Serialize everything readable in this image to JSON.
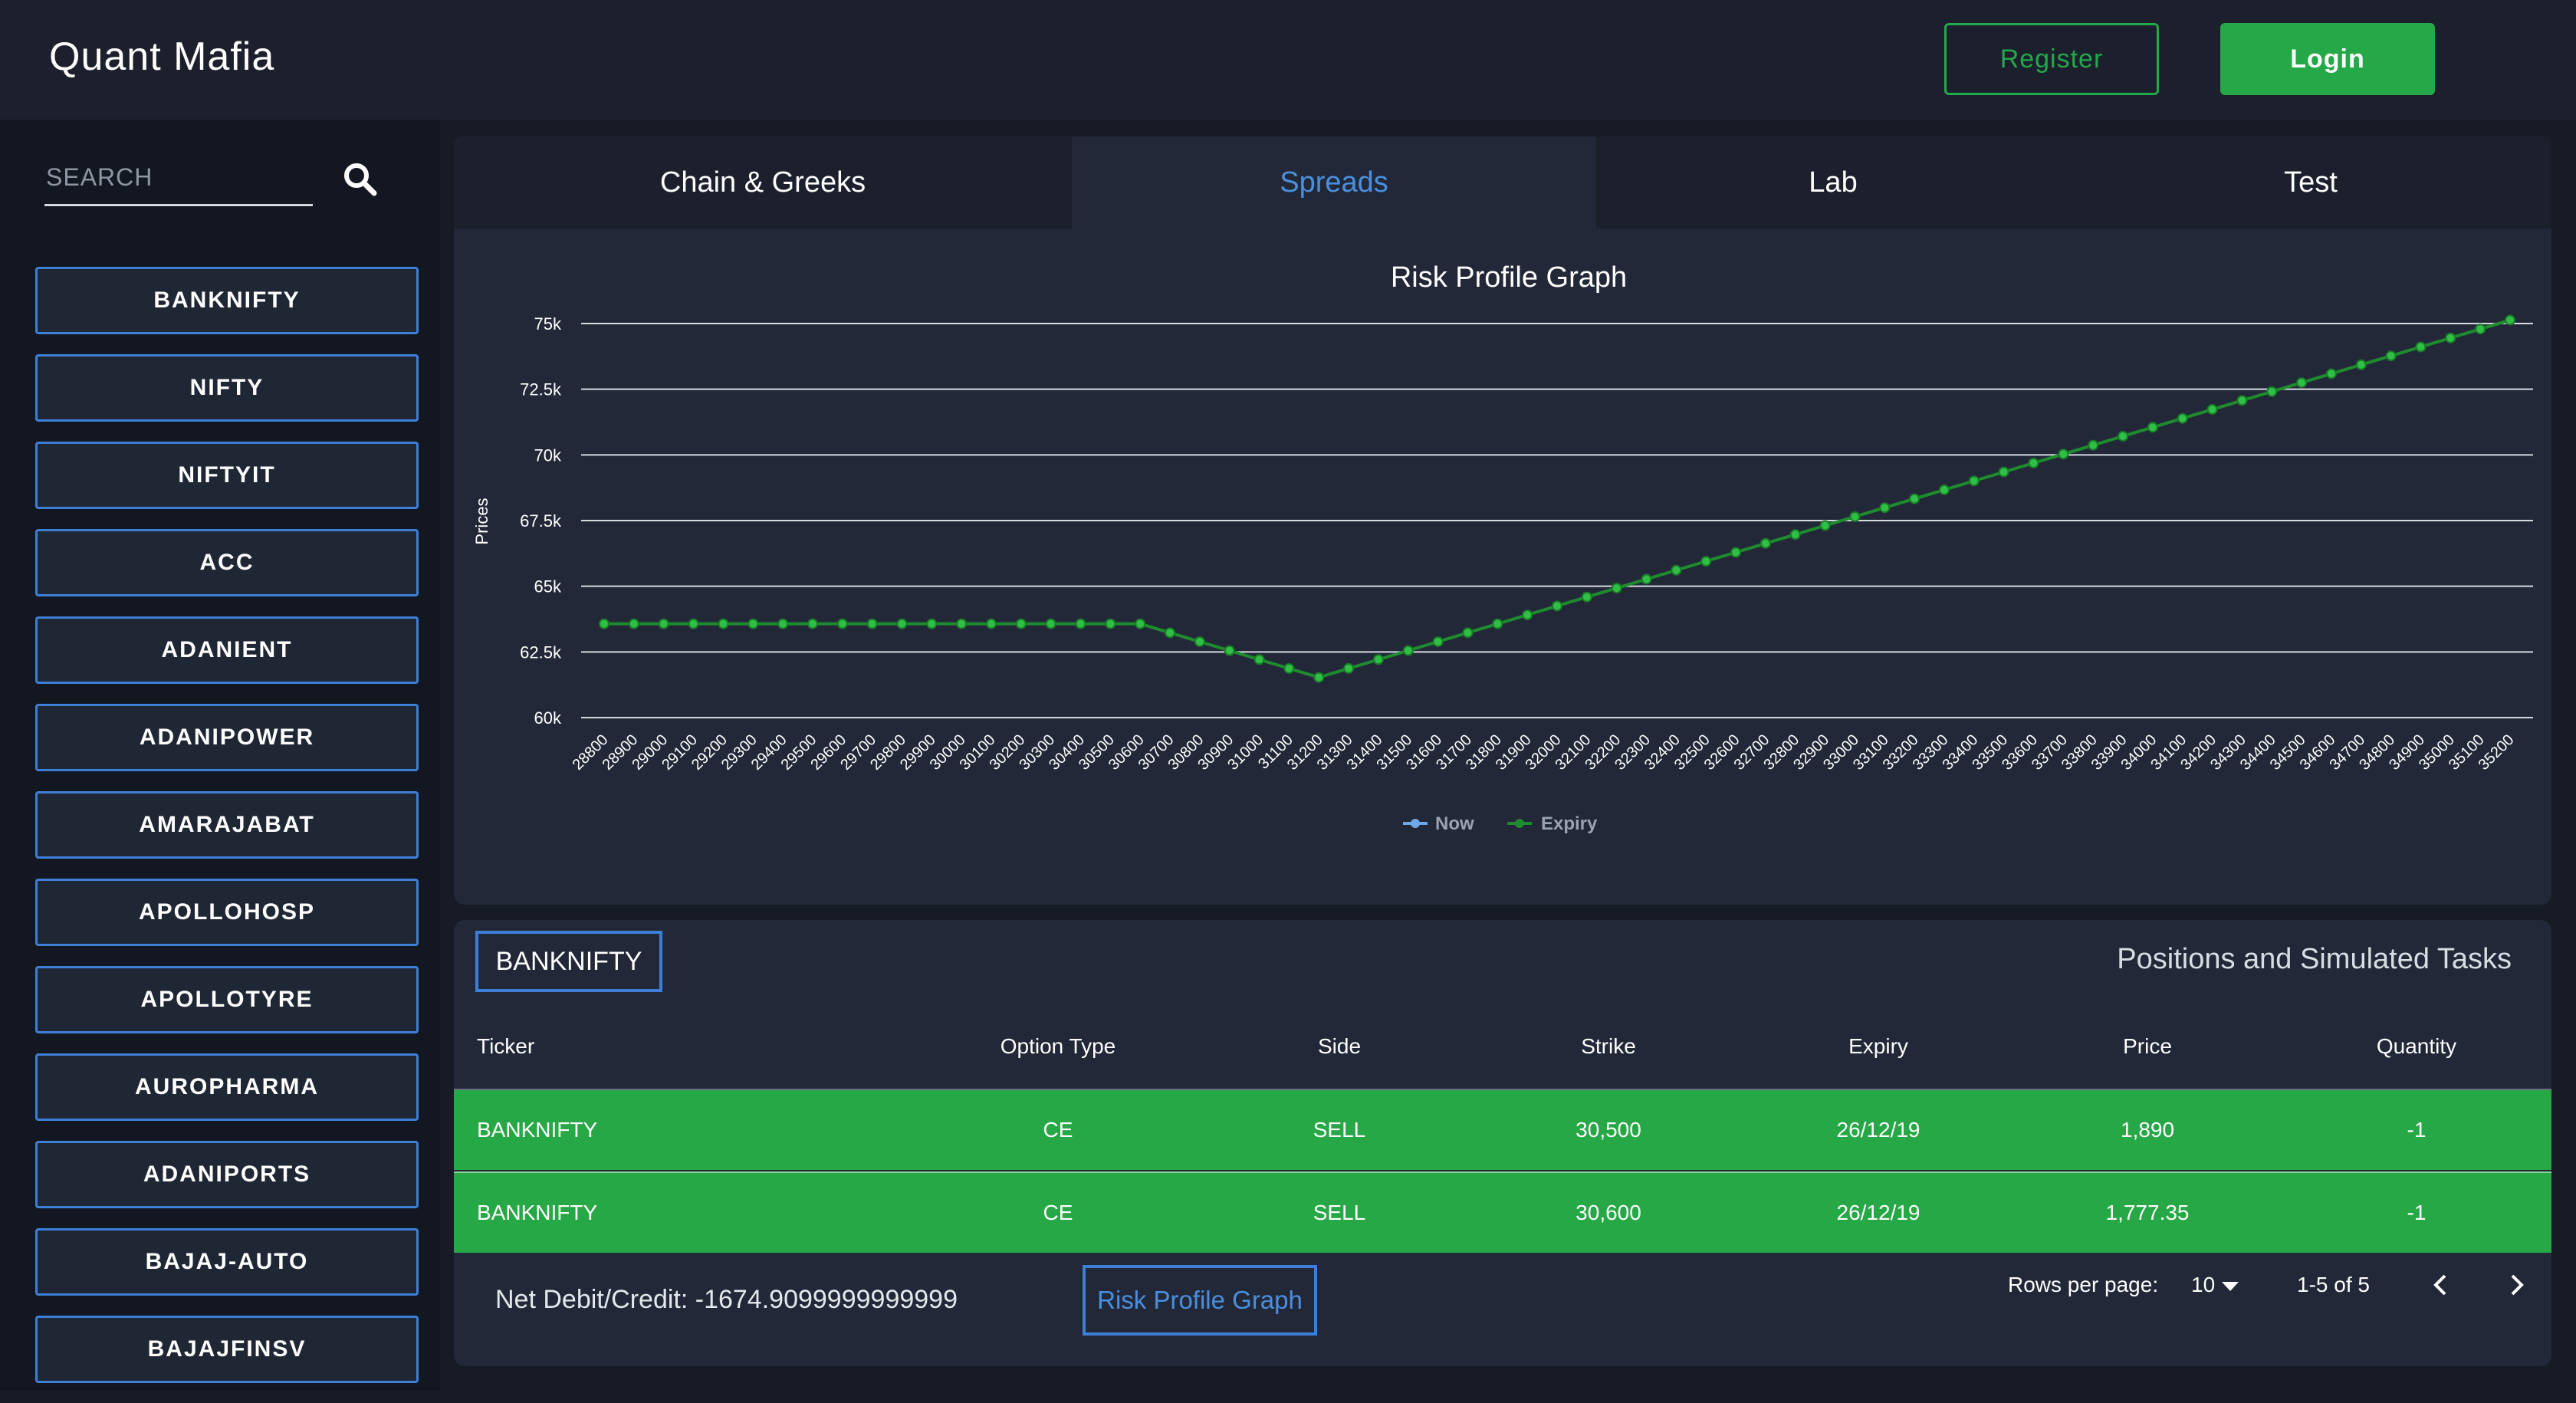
{
  "app": {
    "title": "Quant Mafia"
  },
  "header": {
    "register_label": "Register",
    "login_label": "Login"
  },
  "search": {
    "placeholder": "SEARCH"
  },
  "sidebar": {
    "tickers": [
      "BANKNIFTY",
      "NIFTY",
      "NIFTYIT",
      "ACC",
      "ADANIENT",
      "ADANIPOWER",
      "AMARAJABAT",
      "APOLLOHOSP",
      "APOLLOTYRE",
      "AUROPHARMA",
      "ADANIPORTS",
      "BAJAJ-AUTO",
      "BAJAJFINSV"
    ]
  },
  "tabs": [
    {
      "label": "Chain & Greeks",
      "active": false
    },
    {
      "label": "Spreads",
      "active": true
    },
    {
      "label": "Lab",
      "active": false
    },
    {
      "label": "Test",
      "active": false
    }
  ],
  "colors": {
    "accent": "#4a8fde",
    "brand_green": "#25a948",
    "now_series": "#6ea8e8",
    "expiry_series": "#1e8c2e"
  },
  "chart_data": {
    "type": "line",
    "title": "Risk Profile Graph",
    "xlabel": "",
    "ylabel": "Prices",
    "ylim": [
      60000,
      75000
    ],
    "yticks": [
      60000,
      62500,
      65000,
      67500,
      70000,
      72500,
      75000
    ],
    "ytick_labels": [
      "60k",
      "62.5k",
      "65k",
      "67.5k",
      "70k",
      "72.5k",
      "75k"
    ],
    "x": [
      28800,
      28900,
      29000,
      29100,
      29200,
      29300,
      29400,
      29500,
      29600,
      29700,
      29800,
      29900,
      30000,
      30100,
      30200,
      30300,
      30400,
      30500,
      30600,
      30700,
      30800,
      30900,
      31000,
      31100,
      31200,
      31300,
      31400,
      31500,
      31600,
      31700,
      31800,
      31900,
      32000,
      32100,
      32200,
      32300,
      32400,
      32500,
      32600,
      32700,
      32800,
      32900,
      33000,
      33100,
      33200,
      33300,
      33400,
      33500,
      33600,
      33700,
      33800,
      33900,
      34000,
      34100,
      34200,
      34300,
      34400,
      34500,
      34600,
      34700,
      34800,
      34900,
      35000,
      35100,
      35200
    ],
    "series": [
      {
        "name": "Now",
        "values": []
      },
      {
        "name": "Expiry",
        "values": [
          63570,
          63570,
          63570,
          63570,
          63570,
          63570,
          63570,
          63570,
          63570,
          63570,
          63570,
          63570,
          63570,
          63570,
          63570,
          63570,
          63570,
          63570,
          63570,
          63230,
          62890,
          62550,
          62210,
          61870,
          61530,
          61870,
          62210,
          62550,
          62890,
          63230,
          63570,
          63910,
          64250,
          64590,
          64930,
          65270,
          65610,
          65950,
          66290,
          66630,
          66970,
          67310,
          67650,
          67990,
          68330,
          68670,
          69010,
          69350,
          69690,
          70030,
          70370,
          70710,
          71050,
          71390,
          71730,
          72070,
          72410,
          72750,
          73090,
          73430,
          73770,
          74110,
          74450,
          74790,
          75130
        ]
      }
    ],
    "legend_position": "bottom",
    "grid": true
  },
  "positions": {
    "ticker_chip": "BANKNIFTY",
    "title": "Positions and Simulated Tasks",
    "columns": [
      "Ticker",
      "Option Type",
      "Side",
      "Strike",
      "Expiry",
      "Price",
      "Quantity"
    ],
    "rows": [
      [
        "BANKNIFTY",
        "CE",
        "SELL",
        "30,500",
        "26/12/19",
        "1,890",
        "-1"
      ],
      [
        "BANKNIFTY",
        "CE",
        "SELL",
        "30,600",
        "26/12/19",
        "1,777.35",
        "-1"
      ]
    ],
    "net_label": "Net Debit/Credit: -1674.9099999999999",
    "risk_button_label": "Risk Profile Graph",
    "rows_per_page_label": "Rows per page:",
    "rows_per_page_value": "10",
    "page_info": "1-5 of 5"
  }
}
